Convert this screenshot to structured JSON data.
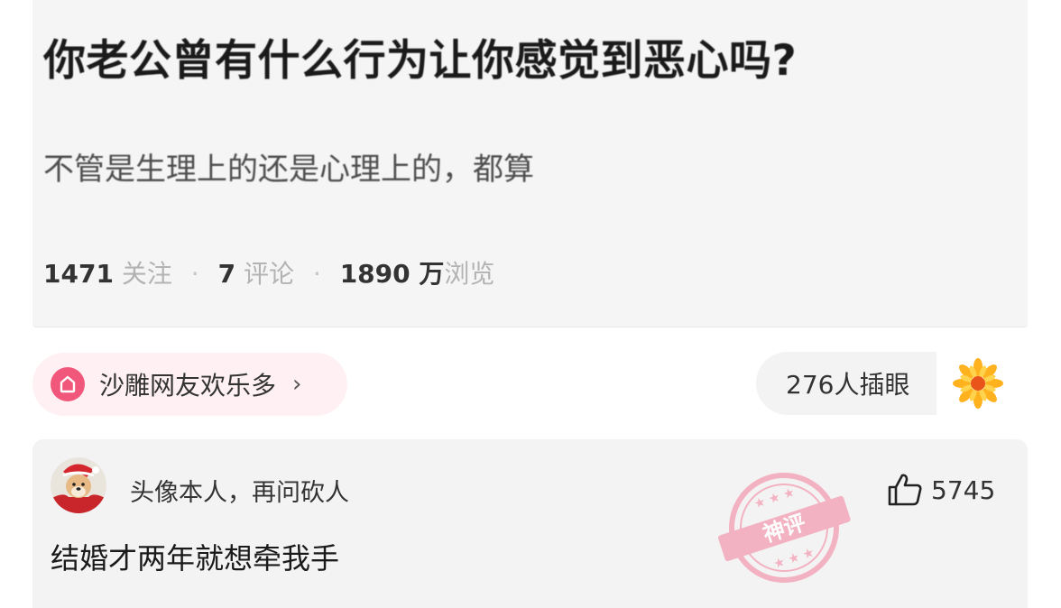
{
  "question": {
    "title": "你老公曾有什么行为让你感觉到恶心吗?",
    "description": "不管是生理上的还是心理上的，都算",
    "stats": {
      "follow_count": "1471",
      "follow_label": "关注",
      "comment_count": "7",
      "comment_label": "评论",
      "view_count": "1890 万",
      "view_label": "浏览"
    }
  },
  "circle": {
    "label": "沙雕网友欢乐多",
    "icon": "house-icon",
    "accent": "#f0577a"
  },
  "reaction": {
    "label": "276人插眼",
    "icon": "flower-icon"
  },
  "comment": {
    "username": "头像本人，再问砍人",
    "like_count": "5745",
    "text": "结婚才两年就想牵我手",
    "stamp_text": "神评",
    "stamp_color": "#f4a7b9"
  }
}
